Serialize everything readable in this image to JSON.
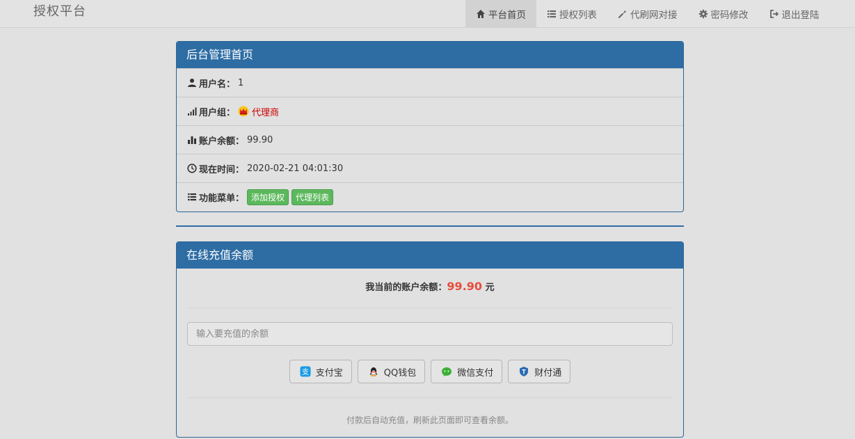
{
  "brand": "授权平台",
  "nav": [
    {
      "label": "平台首页",
      "icon": "home-icon",
      "active": true
    },
    {
      "label": "授权列表",
      "icon": "list-icon"
    },
    {
      "label": "代刷网对接",
      "icon": "wrench-icon"
    },
    {
      "label": "密码修改",
      "icon": "gear-icon"
    },
    {
      "label": "退出登陆",
      "icon": "logout-icon"
    }
  ],
  "admin_panel": {
    "title": "后台管理首页",
    "username_label": "用户名：",
    "username_value": "1",
    "group_label": "用户组：",
    "group_value": "代理商",
    "balance_label": "账户余额：",
    "balance_value": "99.90",
    "time_label": "现在时间：",
    "time_value": "2020-02-21 04:01:30",
    "menu_label": "功能菜单：",
    "menu_buttons": [
      "添加授权",
      "代理列表"
    ]
  },
  "recharge_panel": {
    "title": "在线充值余额",
    "balance_prefix": "我当前的账户余额：",
    "balance_amount": "99.90",
    "balance_unit": "元",
    "input_placeholder": "输入要充值的余额",
    "pay_buttons": [
      {
        "label": "支付宝",
        "icon": "alipay-icon",
        "color": "#1a9be6"
      },
      {
        "label": "QQ钱包",
        "icon": "qq-icon",
        "color": "#222222"
      },
      {
        "label": "微信支付",
        "icon": "wechat-icon",
        "color": "#3cb034"
      },
      {
        "label": "财付通",
        "icon": "tenpay-icon",
        "color": "#2b6cb0"
      }
    ],
    "note": "付款后自动充值，刷新此页面即可查看余额。"
  },
  "colors": {
    "panel_header": "#2e6da4",
    "amount": "#e74c3c",
    "group": "#cc0000",
    "green_button": "#5cb85c"
  }
}
